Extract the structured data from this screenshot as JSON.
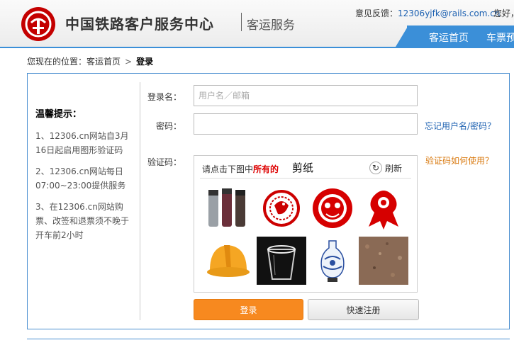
{
  "header": {
    "brand": "中国铁路客户服务中心",
    "sub_brand": "客运服务",
    "feedback_label": "意见反馈：",
    "feedback_email": "12306yjfk@rails.com.cn",
    "greeting": "您好，",
    "nav": [
      "客运首页",
      "车票预"
    ]
  },
  "breadcrumb": {
    "prefix": "您现在的位置：",
    "home": "客运首页",
    "separator": ">",
    "current": "登录"
  },
  "tips": {
    "title": "温馨提示：",
    "items": [
      "1、12306.cn网站自3月16日起启用图形验证码",
      "2、12306.cn网站每日07:00~23:00提供服务",
      "3、在12306.cn网站购票、改签和退票须不晚于开车前2小时"
    ]
  },
  "form": {
    "username_label": "登录名：",
    "username_placeholder": "用户名／邮箱",
    "password_label": "密码：",
    "forgot_link": "忘记用户名/密码？",
    "captcha_label": "验证码：",
    "captcha_help": "验证码如何使用？",
    "login_button": "登录",
    "register_button": "快速注册"
  },
  "captcha": {
    "instruction_pre": "请点击下图中",
    "instruction_em": "所有的",
    "target_word": "剪纸",
    "refresh": "刷新",
    "tiles": [
      "thermos-bottles",
      "paper-cut-circle",
      "paper-cut-mask",
      "paper-cut-figure",
      "hard-hat",
      "plastic-cup",
      "porcelain-vase",
      "stone-texture"
    ]
  },
  "colors": {
    "accent_blue": "#3b8fd8",
    "brand_red": "#c40000",
    "login_orange": "#f7891f",
    "link_blue": "#1a5fb0",
    "help_orange": "#d97a10"
  }
}
